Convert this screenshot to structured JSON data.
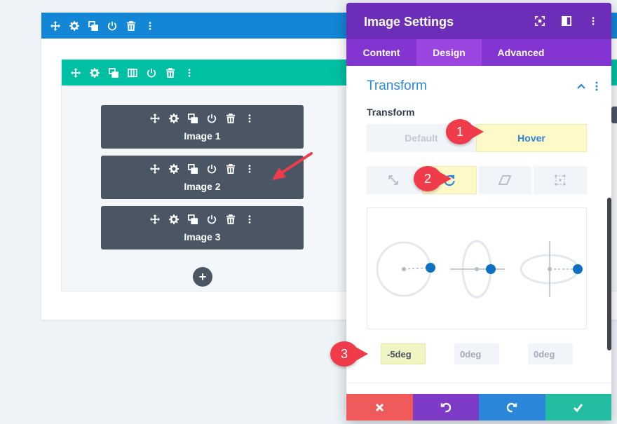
{
  "builder": {
    "modules": [
      {
        "label": "Image 1"
      },
      {
        "label": "Image 2"
      },
      {
        "label": "Image 3"
      }
    ],
    "add_label": "+"
  },
  "panel": {
    "title": "Image Settings",
    "tabs": [
      {
        "label": "Content"
      },
      {
        "label": "Design"
      },
      {
        "label": "Advanced"
      }
    ],
    "active_tab": "Design",
    "group_title": "Transform",
    "field_label": "Transform",
    "mode_options": {
      "default": "Default",
      "hover": "Hover"
    },
    "active_mode": "Hover",
    "subtabs": [
      {
        "icon": "scale-icon"
      },
      {
        "icon": "rotate-icon"
      },
      {
        "icon": "skew-icon"
      },
      {
        "icon": "origin-icon"
      }
    ],
    "active_subtab": "rotate-icon",
    "rotate": {
      "x": "-5deg",
      "y": "0deg",
      "z": "0deg"
    }
  },
  "annotations": [
    "1",
    "2",
    "3"
  ],
  "colors": {
    "section_bar": "#1386d5",
    "row_bar": "#00c0a3",
    "module": "#4b5665",
    "panel_header": "#6c2eb9",
    "panel_tabs": "#8435d1",
    "accent_blue": "#2b87da",
    "highlight": "#fff9c7",
    "badge_red": "#ef3b4a",
    "footer": [
      "#f05a5a",
      "#7d3bc8",
      "#2b87da",
      "#22bda0"
    ]
  }
}
